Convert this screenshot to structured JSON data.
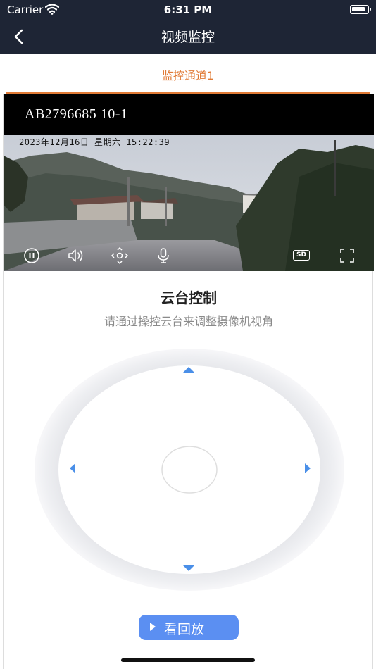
{
  "status_bar": {
    "carrier": "Carrier",
    "time": "6:31 PM"
  },
  "nav": {
    "title": "视频监控"
  },
  "tabs": [
    {
      "label": "监控通道1",
      "active": true
    }
  ],
  "video": {
    "device_name": "AB2796685    10-1",
    "osd_timestamp": "2023年12月16日  星期六  15:22:39",
    "controls": [
      "pause-icon",
      "volume-icon",
      "ptz-icon",
      "microphone-icon",
      "sd-quality-icon",
      "fullscreen-icon"
    ],
    "quality_label": "SD"
  },
  "ptz": {
    "title": "云台控制",
    "description": "请通过操控云台来调整摄像机视角"
  },
  "playback_button": {
    "label": "看回放"
  },
  "colors": {
    "header_bg": "#1e2535",
    "accent": "#e07a35",
    "button": "#5b8ff2",
    "arrow": "#4a8fe8"
  }
}
